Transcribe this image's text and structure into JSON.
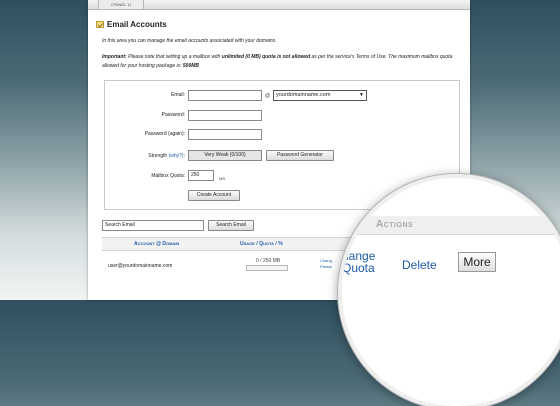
{
  "header": {
    "tab_label": "CPANEL 11"
  },
  "page": {
    "title": "Email Accounts",
    "intro": "In this area you can manage the email accounts associated with your domains.",
    "notice_prefix": "Important:",
    "notice_text1": " Please note that setting up a mailbox with ",
    "notice_strong": "unlimited (0 MB) quota is not allowed",
    "notice_text2": " as per the service's Terms of Use. The maximum mailbox quota allowed for your hosting package is: ",
    "notice_limit": "500MB"
  },
  "form": {
    "email_label": "Email:",
    "email_value": "",
    "at_symbol": "@",
    "domain_selected": "yourdomainname.com",
    "password_label": "Password:",
    "password_again_label": "Password (again):",
    "strength_label": "Strength",
    "strength_why": "(why?)",
    "strength_colon": ":",
    "strength_value": "Very Weak (0/100)",
    "password_generator_label": "Password Generator",
    "quota_label": "Mailbox Quota:",
    "quota_value": "250",
    "quota_unit": "MB",
    "create_label": "Create Account"
  },
  "search": {
    "value": "Search Email",
    "button_label": "Search Email"
  },
  "table": {
    "col_account": "Account @ Domain",
    "col_usage": "Usage / Quota / %",
    "rows": [
      {
        "email": "user@yourdomainname.com",
        "usage": "0 / 250",
        "usage_unit": "MB",
        "usage_fraction": 0,
        "change_label": "Chang",
        "password_label": "Passw"
      }
    ]
  },
  "magnifier": {
    "actions_label": "Actions",
    "change_line1": "hange",
    "change_line2": "Quota",
    "delete_label": "Delete",
    "more_label": "More"
  },
  "colors": {
    "link": "#1c5aa8",
    "background_top": "#2f4f5f",
    "background_bottom": "#f2f4f4"
  }
}
